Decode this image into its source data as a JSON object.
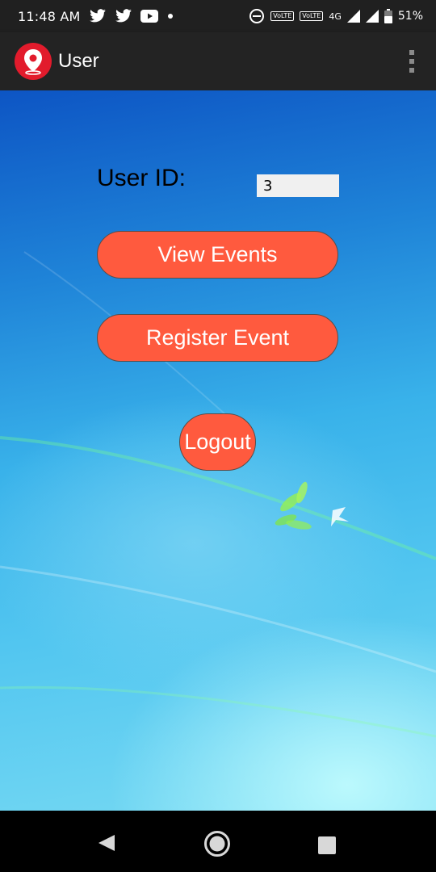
{
  "status_bar": {
    "time": "11:48 AM",
    "battery_percent": "51%",
    "network_type": "4G",
    "volte_badge_1": "VoLTE",
    "volte_badge_2": "VoLTE",
    "notification_icons": [
      "twitter-icon",
      "twitter-icon",
      "youtube-icon",
      "dot-icon"
    ],
    "status_icons": [
      "do-not-disturb-icon",
      "signal-icon",
      "signal-icon",
      "battery-icon"
    ]
  },
  "app_bar": {
    "title": "User",
    "logo_icon": "location-pin-icon",
    "menu_icon": "overflow-menu-icon"
  },
  "main": {
    "user_id_label": "User ID:",
    "user_id_value": "3",
    "view_events_label": "View Events",
    "register_event_label": "Register Event",
    "logout_label": "Logout"
  },
  "nav_bar": {
    "icons": [
      "back-icon",
      "home-icon",
      "recent-apps-icon"
    ]
  },
  "colors": {
    "button": "#ff5a3e",
    "app_bar": "#232323",
    "status_bar": "#202020",
    "logo": "#e21b2c"
  }
}
